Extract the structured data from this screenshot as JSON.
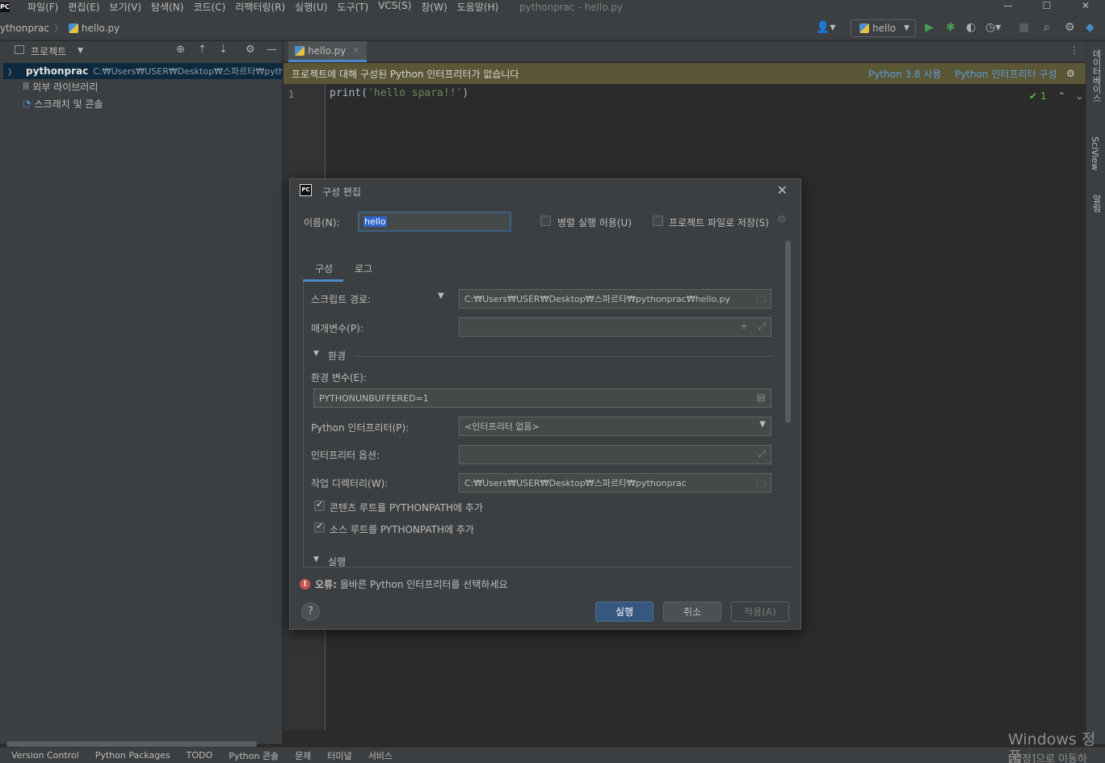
{
  "app": {
    "logo_text": "PC",
    "window_title": "pythonprac - hello.py",
    "menu": [
      "파일(F)",
      "편집(E)",
      "보기(V)",
      "탐색(N)",
      "코드(C)",
      "리팩터링(R)",
      "실행(U)",
      "도구(T)",
      "VCS(S)",
      "창(W)",
      "도움말(H)"
    ],
    "window_controls": [
      "—",
      "☐",
      "✕"
    ]
  },
  "navbar": {
    "project": "ythonprac",
    "file": "hello.py",
    "run_config": "hello"
  },
  "project_panel": {
    "title": "프로젝트",
    "tree": [
      {
        "label": "pythonprac",
        "path": "C:₩Users₩USER₩Desktop₩스파르타₩pytho"
      },
      {
        "label": "외부 라이브러리"
      },
      {
        "label": "스크래치 및 콘솔"
      }
    ]
  },
  "editor": {
    "tab": "hello.py",
    "banner_msg": "프로젝트에 대해 구성된 Python 인터프리터가 없습니다",
    "banner_link1": "Python 3.8 사용",
    "banner_link2": "Python 인터프리터 구성",
    "line_number": "1",
    "code_prefix": "print(",
    "code_string": "'hello spara!!'",
    "code_suffix": ")",
    "inspection_count": "1"
  },
  "right_strip": [
    "데이터베이스",
    "SciView",
    "알림"
  ],
  "statusbar": [
    "Version Control",
    "Python Packages",
    "TODO",
    "Python 콘솔",
    "문제",
    "터미널",
    "서비스"
  ],
  "watermark": {
    "line1": "Windows 정품",
    "line2": "[설정]으로 이동하"
  },
  "dialog": {
    "title": "구성 편집",
    "name_label": "이름(N):",
    "name_value": "hello",
    "parallel_label": "병렬 실행 허용(U)",
    "save_label": "프로젝트 파일로 저장(S)",
    "tabs": [
      "구성",
      "로그"
    ],
    "script_label": "스크립트 경로:",
    "script_value": "C:₩Users₩USER₩Desktop₩스파르타₩pythonprac₩hello.py",
    "params_label": "매개변수(P):",
    "params_value": "",
    "env_section": "환경",
    "env_vars_label": "환경 변수(E):",
    "env_vars_value": "PYTHONUNBUFFERED=1",
    "interp_label": "Python 인터프리터(P):",
    "interp_value": "<인터프리터 없음>",
    "interp_opts_label": "인터프리터 옵션:",
    "interp_opts_value": "",
    "workdir_label": "작업 디렉터리(W):",
    "workdir_value": "C:₩Users₩USER₩Desktop₩스파르타₩pythonprac",
    "content_root_label": "콘텐츠 루트를 PYTHONPATH에 추가",
    "source_root_label": "소스 루트를 PYTHONPATH에 추가",
    "run_section": "실행",
    "error_prefix": "오류:",
    "error_msg": "올바른 Python 인터프리터를 선택하세요",
    "help": "?",
    "buttons": {
      "run": "실행",
      "cancel": "취소",
      "apply": "적용(A)"
    }
  }
}
